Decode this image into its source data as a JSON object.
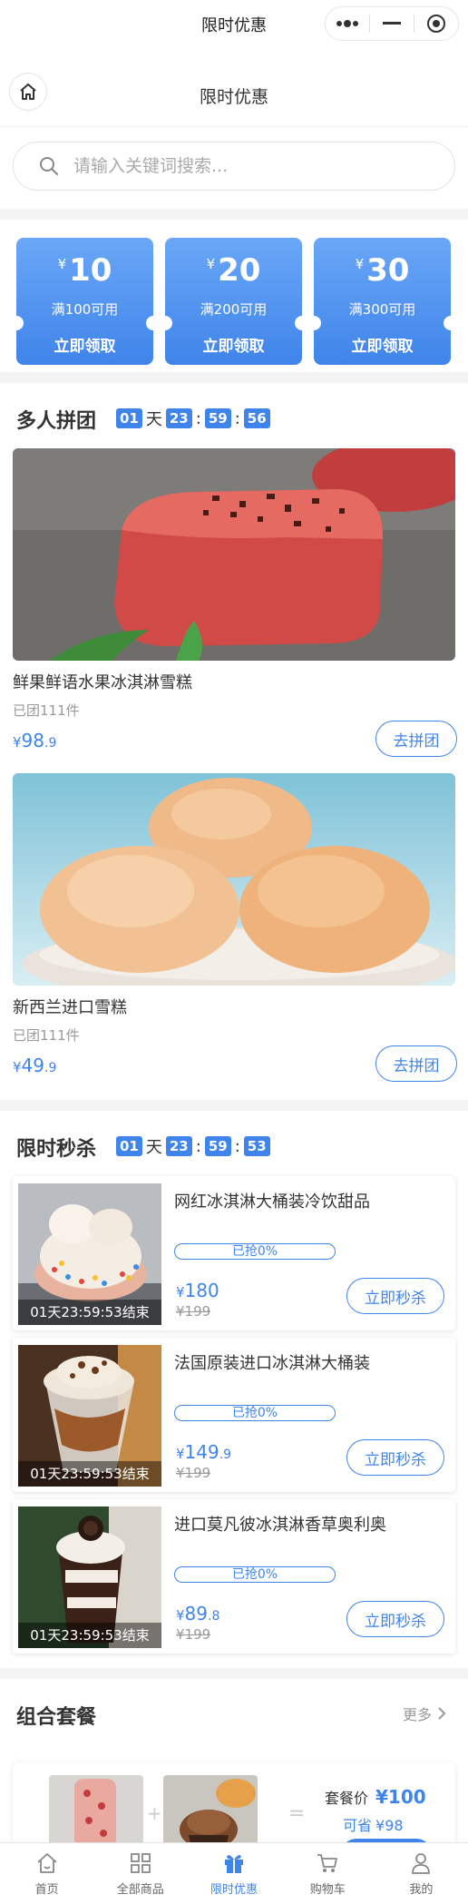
{
  "window": {
    "title": "限时优惠"
  },
  "header": {
    "title": "限时优惠"
  },
  "search": {
    "placeholder": "请输入关键词搜索..."
  },
  "coupons": [
    {
      "currency": "¥",
      "amount": "10",
      "condition": "满100可用",
      "action": "立即领取"
    },
    {
      "currency": "¥",
      "amount": "20",
      "condition": "满200可用",
      "action": "立即领取"
    },
    {
      "currency": "¥",
      "amount": "30",
      "condition": "满300可用",
      "action": "立即领取"
    }
  ],
  "group_buy": {
    "title": "多人拼团",
    "timer": {
      "days": "01",
      "day_unit": "天",
      "hours": "23",
      "minutes": "59",
      "seconds": "56"
    },
    "items": [
      {
        "name": "鲜果鲜语水果冰淇淋雪糕",
        "sold": "已团111件",
        "currency": "¥",
        "price_int": "98",
        "price_dec": ".9",
        "button": "去拼团"
      },
      {
        "name": "新西兰进口雪糕",
        "sold": "已团111件",
        "currency": "¥",
        "price_int": "49",
        "price_dec": ".9",
        "button": "去拼团"
      }
    ]
  },
  "flash_sale": {
    "title": "限时秒杀",
    "timer": {
      "days": "01",
      "day_unit": "天",
      "hours": "23",
      "minutes": "59",
      "seconds": "53"
    },
    "items": [
      {
        "name": "网红冰淇淋大桶装冷饮甜品",
        "ends": "01天23:59:53结束",
        "progress": "已抢0%",
        "currency": "¥",
        "price_int": "180",
        "price_dec": "",
        "original": "¥199",
        "button": "立即秒杀"
      },
      {
        "name": "法国原装进口冰淇淋大桶装",
        "ends": "01天23:59:53结束",
        "progress": "已抢0%",
        "currency": "¥",
        "price_int": "149",
        "price_dec": ".9",
        "original": "¥199",
        "button": "立即秒杀"
      },
      {
        "name": "进口莫凡彼冰淇淋香草奥利奥",
        "ends": "01天23:59:53结束",
        "progress": "已抢0%",
        "currency": "¥",
        "price_int": "89",
        "price_dec": ".8",
        "original": "¥199",
        "button": "立即秒杀"
      }
    ]
  },
  "combo": {
    "title": "组合套餐",
    "more": "更多",
    "plus": "+",
    "equals": "=",
    "package_label": "套餐价",
    "package_price": "¥100",
    "save_label": "可省",
    "save_price": "¥98"
  },
  "tabbar": [
    {
      "label": "首页",
      "icon": "home-icon"
    },
    {
      "label": "全部商品",
      "icon": "grid-icon"
    },
    {
      "label": "限时优惠",
      "icon": "gift-icon",
      "active": true
    },
    {
      "label": "购物车",
      "icon": "cart-icon"
    },
    {
      "label": "我的",
      "icon": "user-icon"
    }
  ],
  "colors": {
    "accent": "#3f84ea",
    "background": "#f4f4f4"
  }
}
